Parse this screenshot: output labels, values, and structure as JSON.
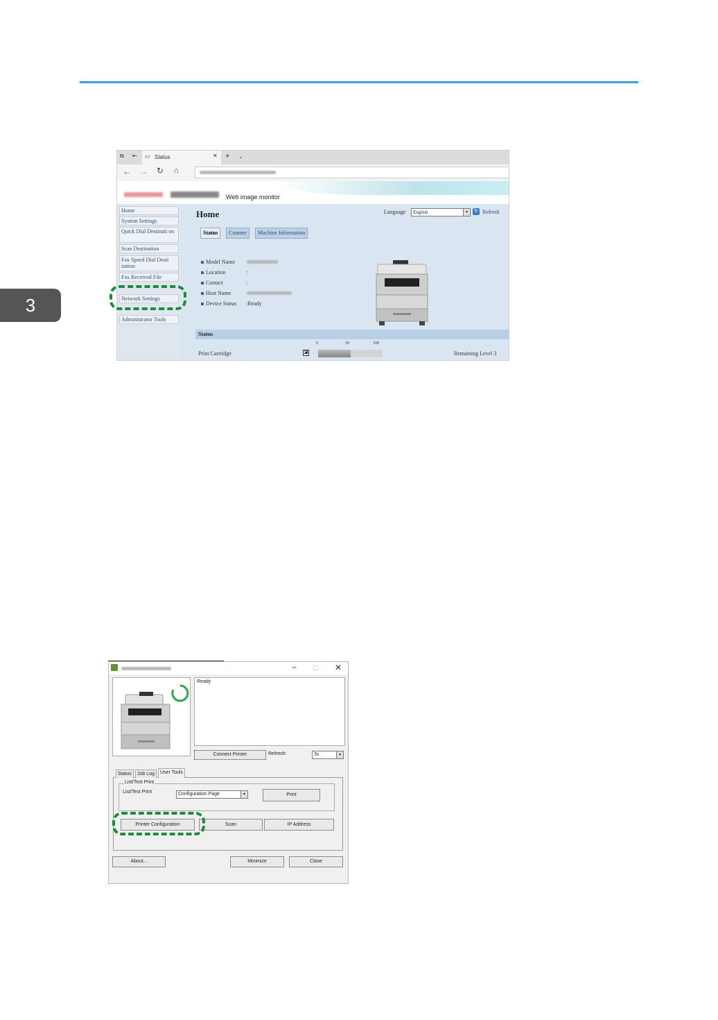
{
  "page": {
    "chapter_number": "3",
    "colors": {
      "accent_rule": "#3d9ed6",
      "highlight_dash": "#1e8a3c",
      "chapter_tab": "#555555"
    }
  },
  "browser": {
    "tab_title": "Status",
    "nav_icons": [
      "back-icon",
      "forward-icon",
      "reload-icon",
      "home-icon"
    ],
    "brand_subtitle": "Web image monitor",
    "sidebar": {
      "items": [
        "Home",
        "System Settings",
        "Quick Dial Destinati on",
        "Scan Destination",
        "Fax Speed Dial Desti nation",
        "Fax Received File",
        "Network Settings",
        "Administrator Tools"
      ],
      "highlighted_item": "Network Settings"
    },
    "main": {
      "title": "Home",
      "language_label": "Language",
      "language_value": "English",
      "refresh_label": "Refresh",
      "tabs": [
        "Status",
        "Counter",
        "Machine Information"
      ],
      "active_tab": "Status",
      "info": [
        {
          "label": "Model Name",
          "value": ""
        },
        {
          "label": "Location",
          "value": ":"
        },
        {
          "label": "Contact",
          "value": ":"
        },
        {
          "label": "Host Name",
          "value": ""
        },
        {
          "label": "Device Status",
          "value": ":Ready"
        }
      ],
      "status_section_title": "Status",
      "gauge_ticks": [
        "0",
        "50",
        "100"
      ],
      "cartridge_label": "Print Cartridge",
      "remaining_label": "Remaining Level 3",
      "remaining_fraction": 0.5
    }
  },
  "app": {
    "status_message": "Ready",
    "connect_printer_label": "Connect Printer",
    "refresh_label": "Refresh:",
    "refresh_value": "3s",
    "tabs": [
      "Status",
      "Job Log",
      "User Tools"
    ],
    "active_tab": "User Tools",
    "group_title": "List/Test Print",
    "list_label": "List/Test Print",
    "list_value": "Configuration Page",
    "print_label": "Print",
    "printer_config_label": "Printer Configuration",
    "scan_label": "Scan",
    "ip_address_label": "IP Address",
    "about_label": "About...",
    "minimize_label": "Minimize",
    "close_label": "Close",
    "window_controls": [
      "minimize-icon",
      "maximize-icon",
      "close-icon"
    ]
  }
}
